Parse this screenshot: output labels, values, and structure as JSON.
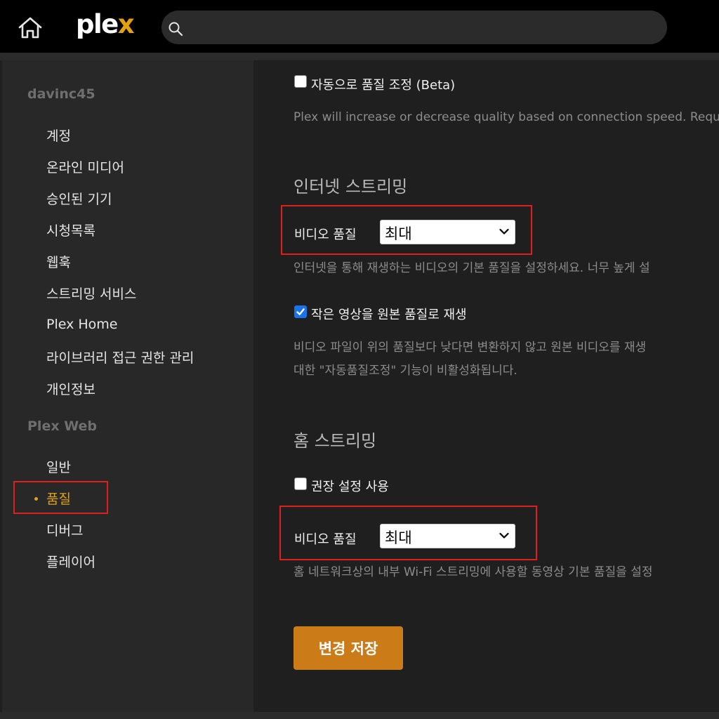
{
  "app": {
    "logo_text": "plex",
    "search_placeholder": ""
  },
  "sidebar": {
    "sections": [
      {
        "title": "davinc45",
        "items": [
          "계정",
          "온라인 미디어",
          "승인된 기기",
          "시청목록",
          "웹훅",
          "스트리밍 서비스",
          "Plex Home",
          "라이브러리 접근 권한 관리",
          "개인정보"
        ]
      },
      {
        "title": "Plex Web",
        "items": [
          "일반",
          "품질",
          "디버그",
          "플레이어"
        ]
      }
    ],
    "active_item": "품질"
  },
  "settings": {
    "auto_quality": {
      "label": "자동으로 품질 조정 (Beta)",
      "checked": false,
      "description": "Plex will increase or decrease quality based on connection speed. Requ"
    },
    "internet_streaming": {
      "title": "인터넷 스트리밍",
      "video_quality_label": "비디오 품질",
      "video_quality_value": "최대",
      "description": "인터넷을 통해 재생하는 비디오의 기본 품질을 설정하세요. 너무 높게 설",
      "play_small_original": {
        "label": "작은 영상을 원본 품질로 재생",
        "checked": true,
        "description_line1": "비디오 파일이 위의 품질보다 낮다면 변환하지 않고 원본 비디오를 재생",
        "description_line2": "대한 \"자동품질조정\" 기능이 비활성화됩니다."
      }
    },
    "home_streaming": {
      "title": "홈 스트리밍",
      "use_recommended": {
        "label": "권장 설정 사용",
        "checked": false
      },
      "video_quality_label": "비디오 품질",
      "video_quality_value": "최대",
      "description": "홈 네트워크상의 내부 Wi-Fi 스트리밍에 사용할 동영상 기본 품질을 설정"
    },
    "save_button": "변경 저장"
  },
  "colors": {
    "accent": "#e5a00d",
    "save_button": "#cc7b19",
    "highlight_box": "#e01e1e",
    "checkbox_checked": "#1a73e8"
  }
}
